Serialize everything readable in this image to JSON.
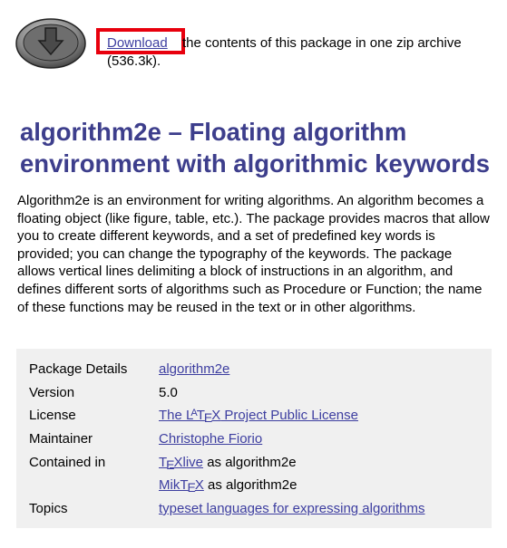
{
  "download": {
    "link_label": "Download",
    "rest_text": "the contents of this package in one zip archive",
    "size_text": "(536.3k)."
  },
  "title": "algorithm2e – Floating algorithm environment with algorithmic keywords",
  "description": "Algorithm2e is an environment for writing algorithms. An algorithm becomes a floating object (like figure, table, etc.). The package provides macros that allow you to create different keywords, and a set of predefined key words is provided; you can change the typography of the keywords. The package allows vertical lines delimiting a block of instructions in an algorithm, and defines different sorts of algorithms such as Procedure or Function; the name of these functions may be reused in the text or in other algorithms.",
  "details": {
    "package_details": {
      "label": "Package Details",
      "value": "algorithm2e"
    },
    "version": {
      "label": "Version",
      "value": "5.0"
    },
    "license": {
      "label": "License",
      "value_pre": "The L",
      "value_mid": "A",
      "value_tex": "T",
      "value_e": "E",
      "value_x": "X",
      "value_post": " Project Public License"
    },
    "maintainer": {
      "label": "Maintainer",
      "value": "Christophe Fiorio"
    },
    "contained_in": {
      "label": "Contained in",
      "texlive": {
        "link_t": "T",
        "link_e": "E",
        "link_rest": "Xlive",
        "suffix": " as algorithm2e"
      },
      "miktex": {
        "link_pre": "MikT",
        "link_e": "E",
        "link_x": "X",
        "suffix": " as algorithm2e"
      }
    },
    "topics": {
      "label": "Topics",
      "value": "typeset languages for expressing algorithms"
    }
  },
  "colors": {
    "title": "#3d3e8c",
    "link": "#3d3ea0",
    "highlight_box": "#e8000d",
    "details_bg": "#f0f0f0"
  },
  "icons": {
    "download": "download-arrow-icon"
  }
}
